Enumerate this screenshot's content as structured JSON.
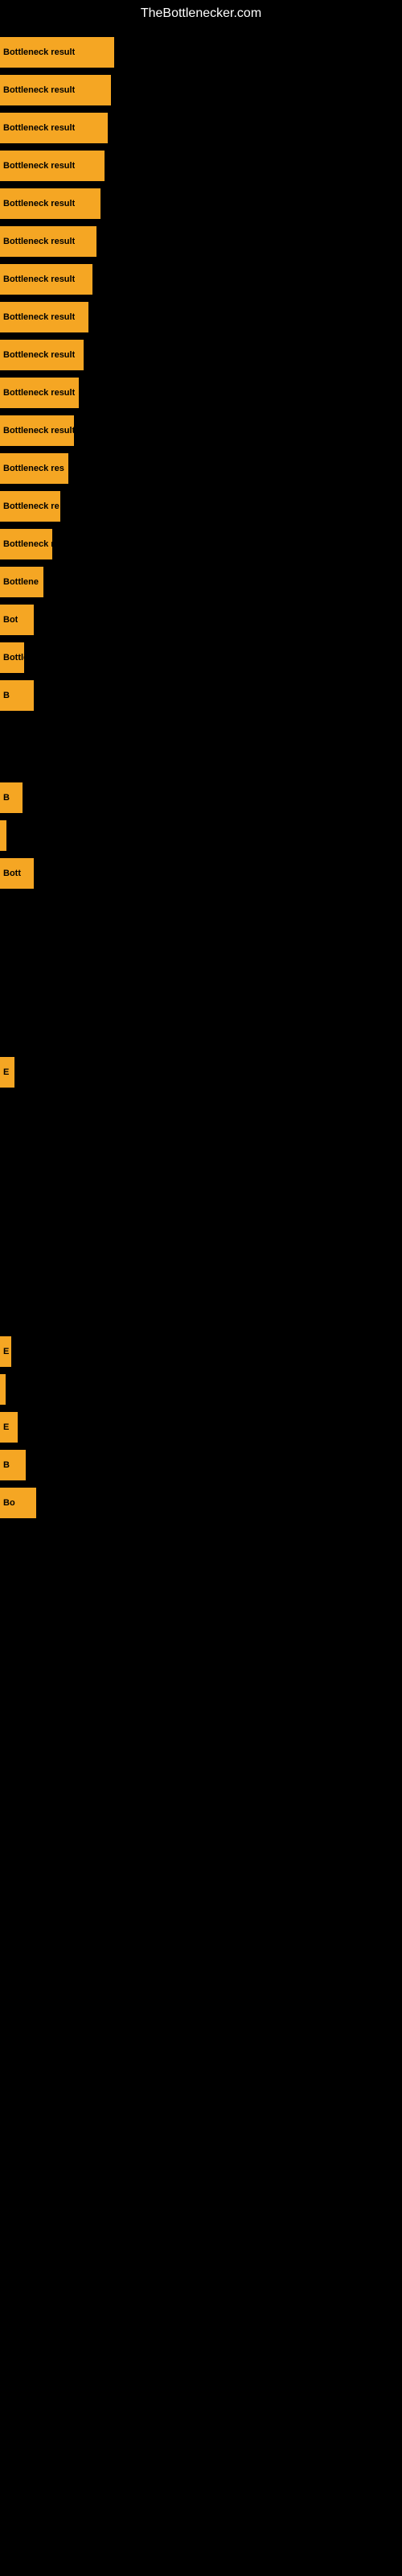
{
  "site": {
    "title": "TheBottlenecker.com"
  },
  "bars": {
    "label": "Bottleneck result",
    "color": "#f5a623",
    "items": [
      {
        "id": 1,
        "width_class": "bar-1",
        "label": "Bottleneck result"
      },
      {
        "id": 2,
        "width_class": "bar-2",
        "label": "Bottleneck result"
      },
      {
        "id": 3,
        "width_class": "bar-3",
        "label": "Bottleneck result"
      },
      {
        "id": 4,
        "width_class": "bar-4",
        "label": "Bottleneck result"
      },
      {
        "id": 5,
        "width_class": "bar-5",
        "label": "Bottleneck result"
      },
      {
        "id": 6,
        "width_class": "bar-6",
        "label": "Bottleneck result"
      },
      {
        "id": 7,
        "width_class": "bar-7",
        "label": "Bottleneck result"
      },
      {
        "id": 8,
        "width_class": "bar-8",
        "label": "Bottleneck result"
      },
      {
        "id": 9,
        "width_class": "bar-9",
        "label": "Bottleneck result"
      },
      {
        "id": 10,
        "width_class": "bar-10",
        "label": "Bottleneck result"
      },
      {
        "id": 11,
        "width_class": "bar-11",
        "label": "Bottleneck result"
      },
      {
        "id": 12,
        "width_class": "bar-12",
        "label": "Bottleneck res"
      },
      {
        "id": 13,
        "width_class": "bar-13",
        "label": "Bottleneck re"
      },
      {
        "id": 14,
        "width_class": "bar-14",
        "label": "Bottleneck r"
      },
      {
        "id": 15,
        "width_class": "bar-15",
        "label": "Bottlene"
      },
      {
        "id": 16,
        "width_class": "bar-16",
        "label": "Bot"
      },
      {
        "id": 17,
        "width_class": "bar-17",
        "label": "Bottlen"
      },
      {
        "id": 18,
        "width_class": "bar-18",
        "label": "B"
      },
      {
        "id": 19,
        "width_class": "bar-19",
        "label": ""
      }
    ]
  },
  "bottom_bars": {
    "items": [
      {
        "id": 1,
        "width_class": "bar-b1",
        "label": "B"
      },
      {
        "id": 2,
        "width_class": "bar-b2",
        "label": ""
      },
      {
        "id": 3,
        "width_class": "bar-b3",
        "label": "Bott"
      },
      {
        "id": 4,
        "width_class": "bar-b4",
        "label": ""
      },
      {
        "id": 5,
        "width_class": "bar-b5",
        "label": "E"
      },
      {
        "id": 6,
        "width_class": "bar-b6",
        "label": ""
      },
      {
        "id": 7,
        "width_class": "bar-b1",
        "label": ""
      },
      {
        "id": 8,
        "width_class": "bar-b2",
        "label": ""
      },
      {
        "id": 9,
        "width_class": "bar-b3",
        "label": "E"
      },
      {
        "id": 10,
        "width_class": "bar-b4",
        "label": "B"
      },
      {
        "id": 11,
        "width_class": "bar-b5",
        "label": "Bo"
      }
    ]
  }
}
